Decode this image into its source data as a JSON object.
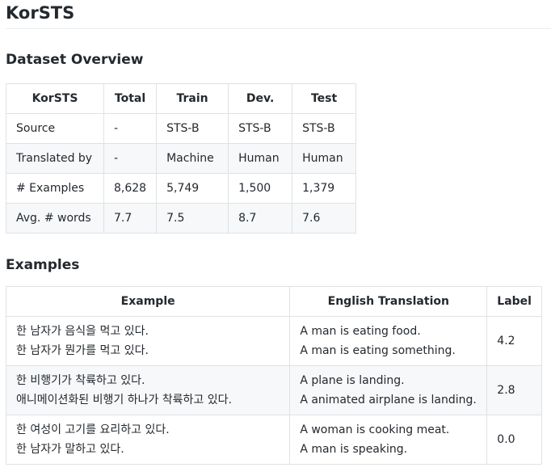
{
  "page_title": "KorSTS",
  "overview": {
    "heading": "Dataset Overview",
    "columns": [
      "KorSTS",
      "Total",
      "Train",
      "Dev.",
      "Test"
    ],
    "rows": [
      [
        "Source",
        "-",
        "STS-B",
        "STS-B",
        "STS-B"
      ],
      [
        "Translated by",
        "-",
        "Machine",
        "Human",
        "Human"
      ],
      [
        "# Examples",
        "8,628",
        "5,749",
        "1,500",
        "1,379"
      ],
      [
        "Avg. # words",
        "7.7",
        "7.5",
        "8.7",
        "7.6"
      ]
    ]
  },
  "examples": {
    "heading": "Examples",
    "columns": [
      "Example",
      "English Translation",
      "Label"
    ],
    "rows": [
      {
        "ko": [
          "한 남자가 음식을 먹고 있다.",
          "한 남자가 뭔가를 먹고 있다."
        ],
        "en": [
          "A man is eating food.",
          "A man is eating something."
        ],
        "label": "4.2"
      },
      {
        "ko": [
          "한 비행기가 착륙하고 있다.",
          "애니메이션화된 비행기 하나가 착륙하고 있다."
        ],
        "en": [
          "A plane is landing.",
          "A animated airplane is landing."
        ],
        "label": "2.8"
      },
      {
        "ko": [
          "한 여성이 고기를 요리하고 있다.",
          "한 남자가 말하고 있다."
        ],
        "en": [
          "A woman is cooking meat.",
          "A man is speaking."
        ],
        "label": "0.0"
      }
    ]
  }
}
